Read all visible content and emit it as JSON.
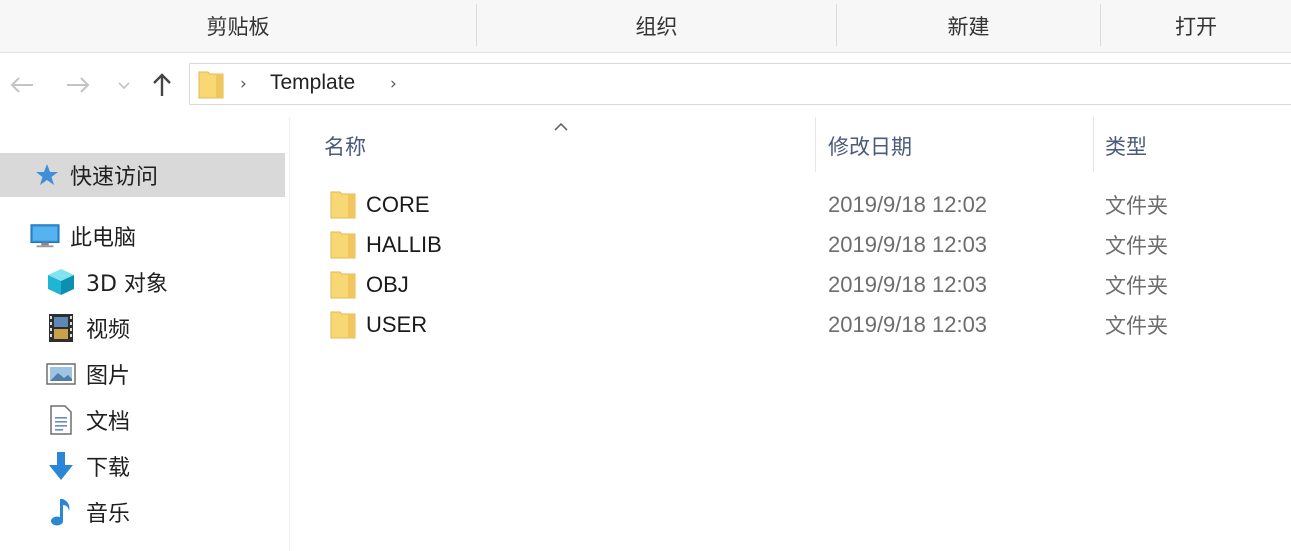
{
  "ribbon": {
    "groups": [
      "剪贴板",
      "组织",
      "新建",
      "打开"
    ]
  },
  "nav": {
    "back_icon": "arrow-left-icon",
    "forward_icon": "arrow-right-icon",
    "recent_icon": "chevron-down-icon",
    "up_icon": "arrow-up-icon",
    "breadcrumb": [
      "Template"
    ]
  },
  "sidebar": {
    "items": [
      {
        "label": "快速访问",
        "icon": "star-icon",
        "selected": true
      },
      {
        "label": "此电脑",
        "icon": "computer-icon"
      },
      {
        "label": "3D 对象",
        "icon": "cube-icon"
      },
      {
        "label": "视频",
        "icon": "film-icon"
      },
      {
        "label": "图片",
        "icon": "picture-icon"
      },
      {
        "label": "文档",
        "icon": "document-icon"
      },
      {
        "label": "下载",
        "icon": "download-arrow-icon"
      },
      {
        "label": "音乐",
        "icon": "music-note-icon"
      }
    ]
  },
  "columns": {
    "name": "名称",
    "modified": "修改日期",
    "type": "类型"
  },
  "files": [
    {
      "name": "CORE",
      "modified": "2019/9/18 12:02",
      "type": "文件夹"
    },
    {
      "name": "HALLIB",
      "modified": "2019/9/18 12:03",
      "type": "文件夹"
    },
    {
      "name": "OBJ",
      "modified": "2019/9/18 12:03",
      "type": "文件夹"
    },
    {
      "name": "USER",
      "modified": "2019/9/18 12:03",
      "type": "文件夹"
    }
  ],
  "colors": {
    "folder": "#f8d775",
    "selection": "#d9d9d9",
    "header_text": "#4a5a7a"
  }
}
